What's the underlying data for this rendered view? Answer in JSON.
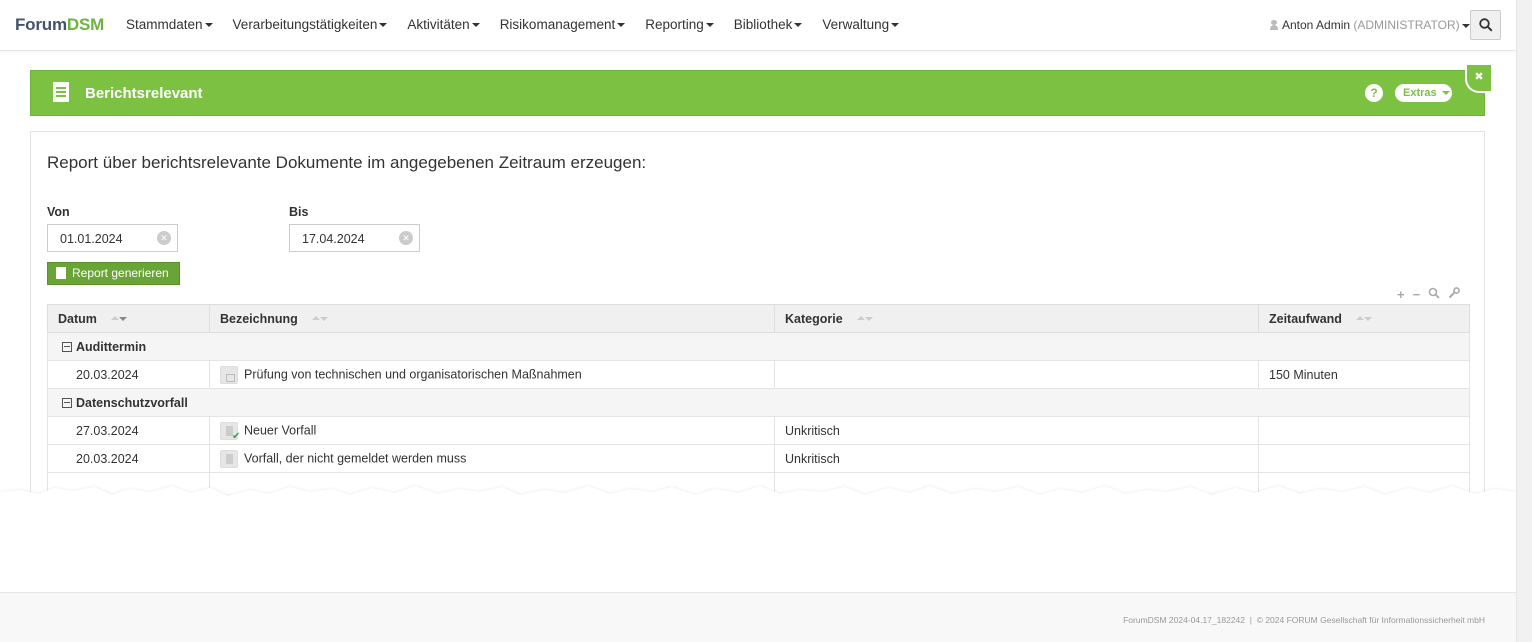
{
  "brand": {
    "part1": "Forum",
    "part2": "DSM"
  },
  "nav": {
    "items": [
      {
        "label": "Stammdaten"
      },
      {
        "label": "Verarbeitungstätigkeiten"
      },
      {
        "label": "Aktivitäten"
      },
      {
        "label": "Risikomanagement"
      },
      {
        "label": "Reporting"
      },
      {
        "label": "Bibliothek"
      },
      {
        "label": "Verwaltung"
      }
    ],
    "user_name": "Anton Admin",
    "user_role": "(ADMINISTRATOR)"
  },
  "header": {
    "title": "Berichtsrelevant",
    "help_label": "?",
    "extras_label": "Extras",
    "close_label": "✖",
    "color": "#7dc143"
  },
  "form": {
    "intro": "Report über berichtsrelevante Dokumente im angegebenen Zeitraum erzeugen:",
    "from_label": "Von",
    "from_value": "01.01.2024",
    "to_label": "Bis",
    "to_value": "17.04.2024",
    "generate_label": "Report generieren",
    "button_color": "#6aa336"
  },
  "grid_tools": {
    "expand": "+",
    "collapse": "−"
  },
  "table": {
    "headers": {
      "datum": "Datum",
      "bezeichnung": "Bezeichnung",
      "kategorie": "Kategorie",
      "zeitaufwand": "Zeitaufwand"
    },
    "groups": [
      {
        "name": "Audittermin",
        "rows": [
          {
            "datum": "20.03.2024",
            "bezeichnung": "Prüfung von technischen und organisatorischen Maßnahmen",
            "kategorie": "",
            "zeitaufwand": "150 Minuten",
            "icon": "lock-icon"
          }
        ]
      },
      {
        "name": "Datenschutzvorfall",
        "rows": [
          {
            "datum": "27.03.2024",
            "bezeichnung": "Neuer Vorfall",
            "kategorie": "Unkritisch",
            "zeitaufwand": "",
            "icon": "document-check-icon"
          },
          {
            "datum": "20.03.2024",
            "bezeichnung": "Vorfall, der nicht gemeldet werden muss",
            "kategorie": "Unkritisch",
            "zeitaufwand": "",
            "icon": "document-icon"
          }
        ]
      }
    ]
  },
  "footer": {
    "version": "ForumDSM 2024-04.17_182242",
    "separator": "|",
    "copyright": "© 2024 FORUM Gesellschaft für Informationssicherheit mbH"
  }
}
